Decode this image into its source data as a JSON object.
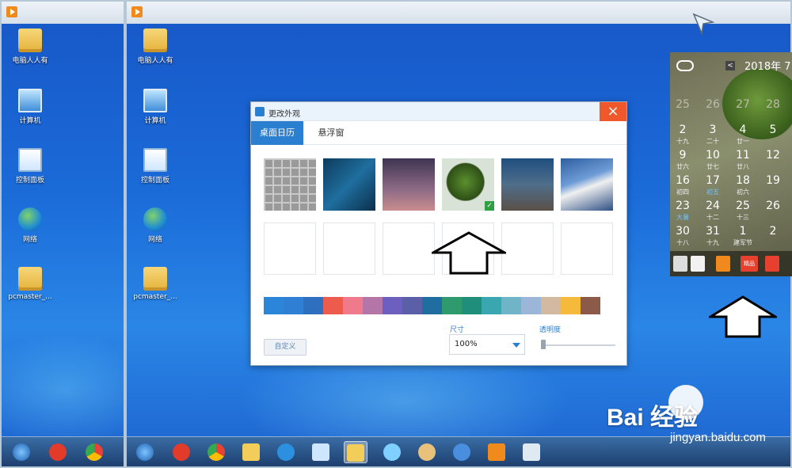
{
  "desktop_icons": [
    {
      "label": "电脑人人有",
      "icon": "folder-user-icon"
    },
    {
      "label": "计算机",
      "icon": "computer-icon"
    },
    {
      "label": "控制面板",
      "icon": "control-panel-icon"
    },
    {
      "label": "网络",
      "icon": "network-icon"
    },
    {
      "label": "pcmaster_...",
      "icon": "folder-icon"
    }
  ],
  "dialog": {
    "title": "更改外观",
    "close_glyph": "×",
    "tabs": [
      {
        "label": "桌面日历",
        "active": true
      },
      {
        "label": "悬浮窗",
        "active": false
      }
    ],
    "custom_button": "自定义",
    "size_label": "尺寸",
    "size_value": "100%",
    "opacity_label": "透明度",
    "opacity_value": 0.0,
    "selected_theme_index": 3,
    "colors": [
      "#2b86d9",
      "#2f7fd5",
      "#2f6fbf",
      "#ec5b4b",
      "#ee7a8c",
      "#b476a8",
      "#6d5fbf",
      "#5a5fa8",
      "#1f6e9f",
      "#2e9a6e",
      "#1f8f7b",
      "#3aa6b0",
      "#6fb5c7",
      "#9bb6d8",
      "#d2b99f",
      "#f5b93b",
      "#8c5a48"
    ]
  },
  "calendar": {
    "year_month": "2018年 7",
    "prev_glyph": "<",
    "days": [
      {
        "d": "25",
        "s": "",
        "dim": true
      },
      {
        "d": "26",
        "s": "",
        "dim": true
      },
      {
        "d": "27",
        "s": "",
        "dim": true
      },
      {
        "d": "28",
        "s": "",
        "dim": true
      },
      {
        "d": "2",
        "s": "十九"
      },
      {
        "d": "3",
        "s": "二十"
      },
      {
        "d": "4",
        "s": "廿一"
      },
      {
        "d": "5",
        "s": ""
      },
      {
        "d": "9",
        "s": "廿六"
      },
      {
        "d": "10",
        "s": "廿七"
      },
      {
        "d": "11",
        "s": "廿八"
      },
      {
        "d": "12",
        "s": ""
      },
      {
        "d": "16",
        "s": "初四"
      },
      {
        "d": "17",
        "s": "初五"
      },
      {
        "d": "18",
        "s": "初六"
      },
      {
        "d": "19",
        "s": ""
      },
      {
        "d": "23",
        "s": "大暑"
      },
      {
        "d": "24",
        "s": "十二"
      },
      {
        "d": "25",
        "s": "十三"
      },
      {
        "d": "26",
        "s": ""
      },
      {
        "d": "30",
        "s": "十八"
      },
      {
        "d": "31",
        "s": "十九"
      },
      {
        "d": "1",
        "s": "建军节"
      },
      {
        "d": "2",
        "s": ""
      }
    ],
    "toolbar_item_label": "精品"
  },
  "watermark": {
    "brand": "Bai  经验",
    "url": "jingyan.baidu.com"
  },
  "taskbar": {
    "start_icon": "windows-start-icon"
  }
}
